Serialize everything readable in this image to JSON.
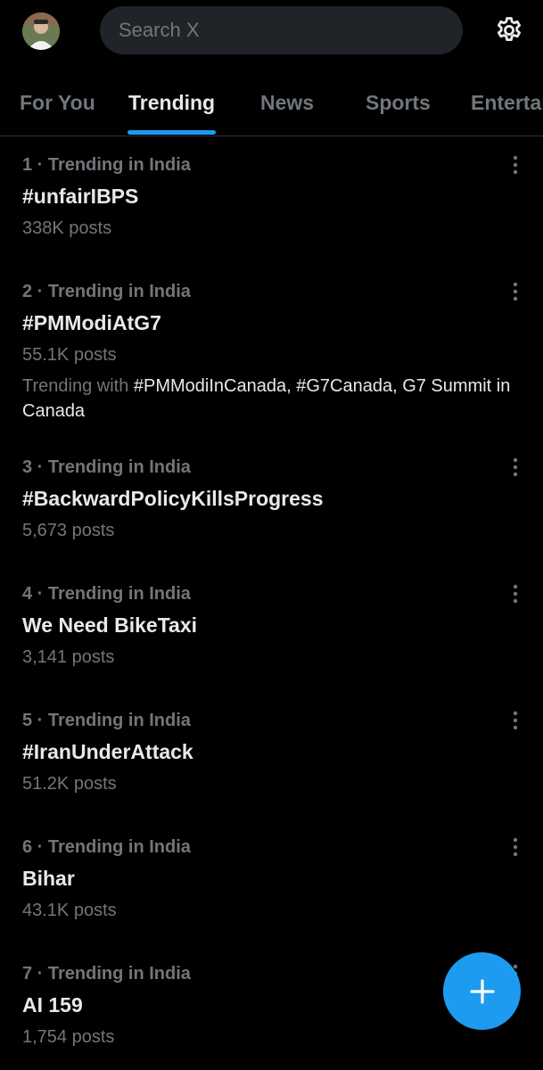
{
  "header": {
    "search_placeholder": "Search X"
  },
  "tabs": [
    {
      "label": "For You"
    },
    {
      "label": "Trending",
      "active": true
    },
    {
      "label": "News"
    },
    {
      "label": "Sports"
    },
    {
      "label": "Entertainment"
    }
  ],
  "trends": [
    {
      "meta": "1 · Trending in India",
      "title": "#unfairIBPS",
      "posts": "338K posts"
    },
    {
      "meta": "2 · Trending in India",
      "title": "#PMModiAtG7",
      "posts": "55.1K posts",
      "trending_with_label": "Trending with",
      "trending_with_tags": "#PMModiInCanada, #G7Canada, G7 Summit in Canada"
    },
    {
      "meta": "3 · Trending in India",
      "title": "#BackwardPolicyKillsProgress",
      "posts": "5,673 posts"
    },
    {
      "meta": "4 · Trending in India",
      "title": "We Need BikeTaxi",
      "posts": "3,141 posts"
    },
    {
      "meta": "5 · Trending in India",
      "title": "#IranUnderAttack",
      "posts": "51.2K posts"
    },
    {
      "meta": "6 · Trending in India",
      "title": "Bihar",
      "posts": "43.1K posts"
    },
    {
      "meta": "7 · Trending in India",
      "title": "AI 159",
      "posts": "1,754 posts"
    }
  ],
  "colors": {
    "background": "#000000",
    "accent": "#1d9bf0",
    "primary_text": "#e7e9ea",
    "secondary_text": "#71767b",
    "search_bg": "#202327"
  },
  "icons": {
    "settings": "gear-icon",
    "more": "more-vertical-icon",
    "compose": "plus-icon"
  }
}
